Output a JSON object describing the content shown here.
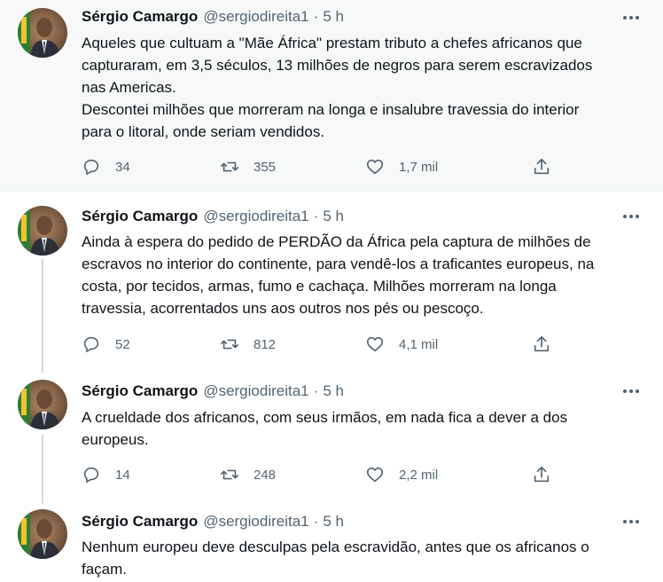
{
  "colors": {
    "text_primary": "#0f1419",
    "text_secondary": "#536471",
    "highlight_bg": "#f7f9f9",
    "thread_line": "#cfd9de"
  },
  "icons": {
    "reply": "reply-icon",
    "retweet": "retweet-icon",
    "like": "heart-icon",
    "share": "share-icon",
    "more": "more-dots-icon"
  },
  "tweets": [
    {
      "author": "Sérgio Camargo",
      "handle": "@sergiodireita1",
      "separator": "·",
      "time": "5 h",
      "text": "Aqueles que cultuam a \"Mãe África\" prestam tributo a chefes africanos que\ncapturaram, em 3,5 séculos, 13 milhões de negros para serem escravizados\nnas Americas.\nDescontei milhões que morreram na longa e insalubre travessia do interior\npara o litoral, onde seriam vendidos.",
      "replies": "34",
      "retweets": "355",
      "likes": "1,7 mil"
    },
    {
      "author": "Sérgio Camargo",
      "handle": "@sergiodireita1",
      "separator": "·",
      "time": "5 h",
      "text": "Ainda à espera do pedido de PERDÃO da África pela captura de milhões de\nescravos no interior do continente, para vendê-los a traficantes europeus, na\ncosta, por tecidos, armas, fumo e cachaça. Milhões morreram na longa\ntravessia, acorrentados uns aos outros nos pés ou pescoço.",
      "replies": "52",
      "retweets": "812",
      "likes": "4,1 mil"
    },
    {
      "author": "Sérgio Camargo",
      "handle": "@sergiodireita1",
      "separator": "·",
      "time": "5 h",
      "text": "A crueldade dos africanos, com seus irmãos, em nada fica a dever a dos\neuropeus.",
      "replies": "14",
      "retweets": "248",
      "likes": "2,2 mil"
    },
    {
      "author": "Sérgio Camargo",
      "handle": "@sergiodireita1",
      "separator": "·",
      "time": "5 h",
      "text": "Nenhum europeu deve desculpas pela escravidão, antes que os africanos o\nfaçam."
    }
  ]
}
